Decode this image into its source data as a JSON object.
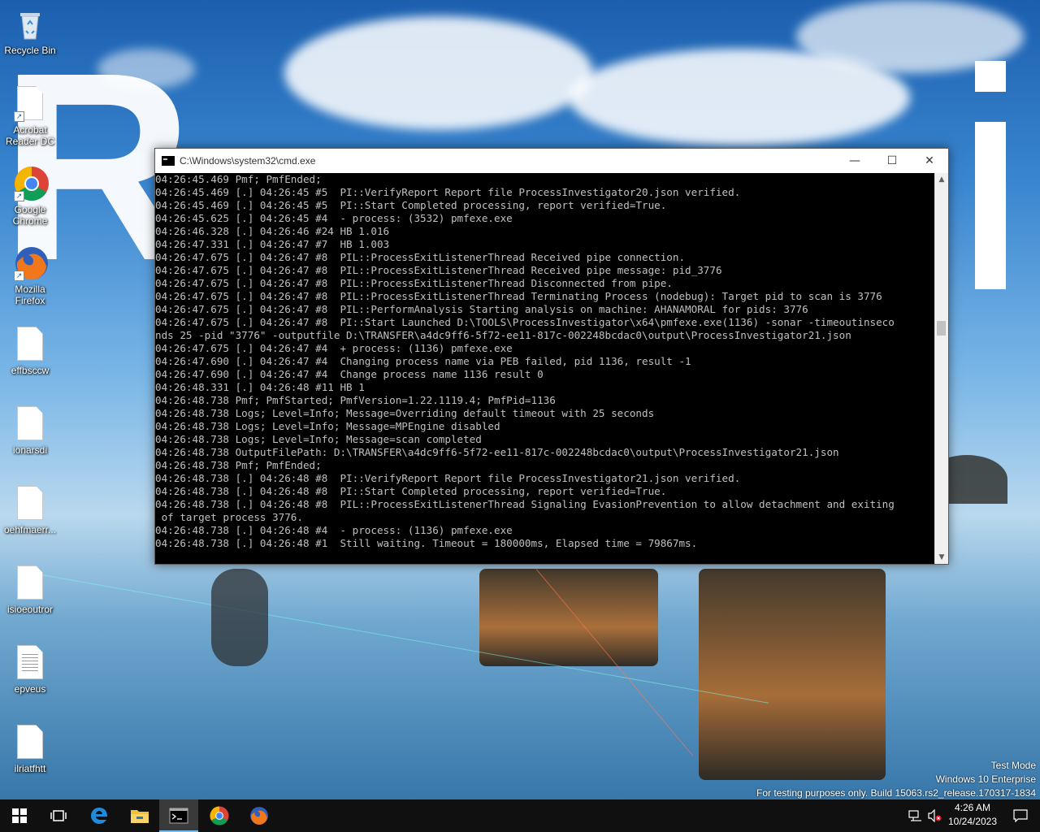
{
  "desktop": {
    "icons": [
      {
        "label": "Recycle Bin",
        "icon": "recycle-bin-icon"
      },
      {
        "label": "Acrobat Reader DC",
        "icon": "acrobat-icon"
      },
      {
        "label": "Google Chrome",
        "icon": "chrome-icon"
      },
      {
        "label": "Mozilla Firefox",
        "icon": "firefox-icon"
      },
      {
        "label": "effbsccw",
        "icon": "document-icon"
      },
      {
        "label": "ionarsdi",
        "icon": "document-icon"
      },
      {
        "label": "oehfmaerr...",
        "icon": "document-icon"
      },
      {
        "label": "isioeoutror",
        "icon": "document-icon"
      },
      {
        "label": "epveus",
        "icon": "text-document-icon"
      },
      {
        "label": "ilriatfhtt",
        "icon": "document-icon"
      }
    ]
  },
  "cmd": {
    "title": "C:\\Windows\\system32\\cmd.exe",
    "minimize": "—",
    "maximize": "☐",
    "close": "✕",
    "lines": [
      "04:26:45.469 Pmf; PmfEnded;",
      "04:26:45.469 [.] 04:26:45 #5  PI::VerifyReport Report file ProcessInvestigator20.json verified.",
      "04:26:45.469 [.] 04:26:45 #5  PI::Start Completed processing, report verified=True.",
      "04:26:45.625 [.] 04:26:45 #4  - process: (3532) pmfexe.exe",
      "04:26:46.328 [.] 04:26:46 #24 HB 1.016",
      "04:26:47.331 [.] 04:26:47 #7  HB 1.003",
      "04:26:47.675 [.] 04:26:47 #8  PIL::ProcessExitListenerThread Received pipe connection.",
      "04:26:47.675 [.] 04:26:47 #8  PIL::ProcessExitListenerThread Received pipe message: pid_3776",
      "04:26:47.675 [.] 04:26:47 #8  PIL::ProcessExitListenerThread Disconnected from pipe.",
      "04:26:47.675 [.] 04:26:47 #8  PIL::ProcessExitListenerThread Terminating Process (nodebug): Target pid to scan is 3776",
      "04:26:47.675 [.] 04:26:47 #8  PIL::PerformAnalysis Starting analysis on machine: AHANAMORAL for pids: 3776",
      "04:26:47.675 [.] 04:26:47 #8  PI::Start Launched D:\\TOOLS\\ProcessInvestigator\\x64\\pmfexe.exe(1136) -sonar -timeoutinseco",
      "nds 25 -pid \"3776\" -outputfile D:\\TRANSFER\\a4dc9ff6-5f72-ee11-817c-002248bcdac0\\output\\ProcessInvestigator21.json",
      "04:26:47.675 [.] 04:26:47 #4  + process: (1136) pmfexe.exe",
      "04:26:47.690 [.] 04:26:47 #4  Changing process name via PEB failed, pid 1136, result -1",
      "04:26:47.690 [.] 04:26:47 #4  Change process name 1136 result 0",
      "04:26:48.331 [.] 04:26:48 #11 HB 1",
      "04:26:48.738 Pmf; PmfStarted; PmfVersion=1.22.1119.4; PmfPid=1136",
      "04:26:48.738 Logs; Level=Info; Message=Overriding default timeout with 25 seconds",
      "04:26:48.738 Logs; Level=Info; Message=MPEngine disabled",
      "04:26:48.738 Logs; Level=Info; Message=scan completed",
      "04:26:48.738 OutputFilePath: D:\\TRANSFER\\a4dc9ff6-5f72-ee11-817c-002248bcdac0\\output\\ProcessInvestigator21.json",
      "04:26:48.738 Pmf; PmfEnded;",
      "04:26:48.738 [.] 04:26:48 #8  PI::VerifyReport Report file ProcessInvestigator21.json verified.",
      "04:26:48.738 [.] 04:26:48 #8  PI::Start Completed processing, report verified=True.",
      "04:26:48.738 [.] 04:26:48 #8  PIL::ProcessExitListenerThread Signaling EvasionPrevention to allow detachment and exiting",
      " of target process 3776.",
      "04:26:48.738 [.] 04:26:48 #4  - process: (1136) pmfexe.exe",
      "04:26:48.738 [.] 04:26:48 #1  Still waiting. Timeout = 180000ms, Elapsed time = 79867ms."
    ]
  },
  "watermark": {
    "line1": "Test Mode",
    "line2": "Windows 10 Enterprise",
    "line3": "For testing purposes only. Build 15063.rs2_release.170317-1834"
  },
  "taskbar": {
    "items": [
      "start-icon",
      "task-view-icon",
      "edge-icon",
      "file-explorer-icon",
      "cmd-icon",
      "chrome-icon",
      "firefox-icon"
    ],
    "time": "4:26 AM",
    "date": "10/24/2023"
  }
}
